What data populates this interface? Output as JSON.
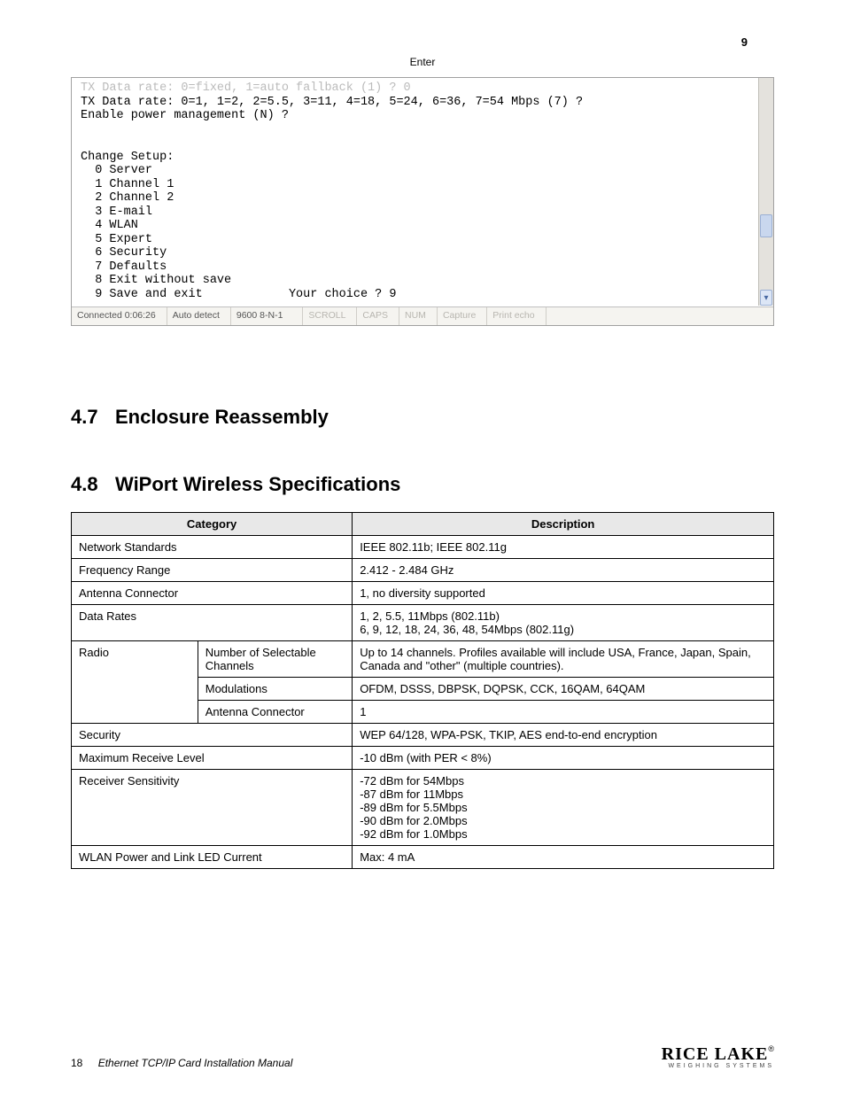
{
  "topright_step": "9",
  "center_key": "Enter",
  "terminal": {
    "line_faint": "TX Data rate: 0=fixed, 1=auto fallback (1) ? 0",
    "line1": "TX Data rate: 0=1, 1=2, 2=5.5, 3=11, 4=18, 5=24, 6=36, 7=54 Mbps (7) ?",
    "line2": "Enable power management (N) ?",
    "menu_head": "Change Setup:",
    "menu": [
      "  0 Server",
      "  1 Channel 1",
      "  2 Channel 2",
      "  3 E-mail",
      "  4 WLAN",
      "  5 Expert",
      "  6 Security",
      "  7 Defaults",
      "  8 Exit without save",
      "  9 Save and exit            Your choice ? 9"
    ],
    "status": {
      "s0": "Connected 0:06:26",
      "s1": "Auto detect",
      "s2": "9600 8-N-1",
      "s3": "SCROLL",
      "s4": "CAPS",
      "s5": "NUM",
      "s6": "Capture",
      "s7": "Print echo"
    }
  },
  "sections": {
    "s47_num": "4.7",
    "s47_title": "Enclosure Reassembly",
    "s48_num": "4.8",
    "s48_title": "WiPort Wireless Specifications"
  },
  "table": {
    "head_cat": "Category",
    "head_desc": "Description",
    "rows": [
      {
        "c1": "Network Standards",
        "c2": "",
        "d": "IEEE 802.11b; IEEE 802.11g",
        "span": 2
      },
      {
        "c1": "Frequency Range",
        "c2": "",
        "d": "2.412 - 2.484 GHz",
        "span": 2
      },
      {
        "c1": "Antenna Connector",
        "c2": "",
        "d": "1, no diversity supported",
        "span": 2
      },
      {
        "c1": "Data Rates",
        "c2": "",
        "d": "1, 2, 5.5, 11Mbps (802.11b)\n6, 9, 12, 18, 24, 36, 48, 54Mbps (802.11g)",
        "span": 2
      },
      {
        "c1": "Radio",
        "c2": "Number of Selectable Channels",
        "d": "Up to 14 channels. Profiles available will include USA, France, Japan, Spain, Canada and \"other\" (multiple countries).",
        "rowspan": 3
      },
      {
        "c1": "",
        "c2": "Modulations",
        "d": "OFDM, DSSS, DBPSK, DQPSK, CCK, 16QAM, 64QAM"
      },
      {
        "c1": "",
        "c2": "Antenna Connector",
        "d": "1"
      },
      {
        "c1": "Security",
        "c2": "",
        "d": "WEP 64/128, WPA-PSK, TKIP, AES end-to-end encryption",
        "span": 2
      },
      {
        "c1": "Maximum Receive Level",
        "c2": "",
        "d": "-10 dBm (with PER < 8%)",
        "span": 2
      },
      {
        "c1": "Receiver Sensitivity",
        "c2": "",
        "d": "-72 dBm for 54Mbps\n-87 dBm for 11Mbps\n-89 dBm for 5.5Mbps\n-90 dBm for 2.0Mbps\n-92 dBm for 1.0Mbps",
        "span": 2
      },
      {
        "c1": "WLAN Power and Link LED Current",
        "c2": "",
        "d": "Max: 4 mA",
        "span": 2
      }
    ]
  },
  "footer": {
    "page": "18",
    "title": "Ethernet TCP/IP Card Installation Manual",
    "brand_main": "RICE LAKE",
    "brand_sub": "WEIGHING SYSTEMS"
  }
}
